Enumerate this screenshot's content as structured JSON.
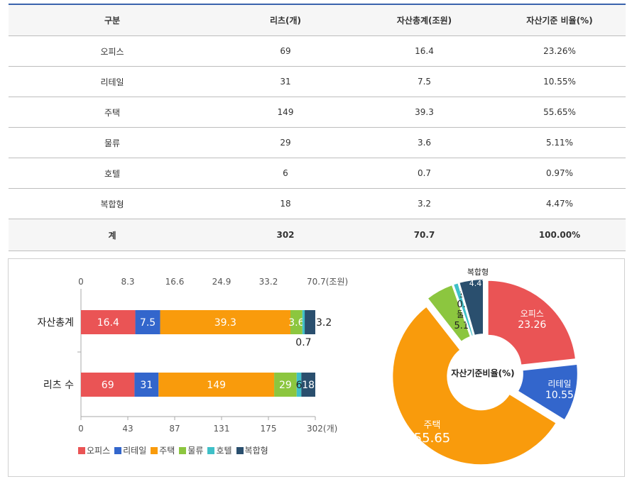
{
  "table": {
    "headers": [
      "구분",
      "리츠(개)",
      "자산총계(조원)",
      "자산기준 비율(%)"
    ],
    "rows": [
      {
        "cat": "오피스",
        "reits": "69",
        "assets": "16.4",
        "ratio": "23.26%"
      },
      {
        "cat": "리테일",
        "reits": "31",
        "assets": "7.5",
        "ratio": "10.55%"
      },
      {
        "cat": "주택",
        "reits": "149",
        "assets": "39.3",
        "ratio": "55.65%"
      },
      {
        "cat": "물류",
        "reits": "29",
        "assets": "3.6",
        "ratio": "5.11%"
      },
      {
        "cat": "호텔",
        "reits": "6",
        "assets": "0.7",
        "ratio": "0.97%"
      },
      {
        "cat": "복합형",
        "reits": "18",
        "assets": "3.2",
        "ratio": "4.47%"
      }
    ],
    "total": {
      "cat": "계",
      "reits": "302",
      "assets": "70.7",
      "ratio": "100.00%"
    }
  },
  "chart_data": [
    {
      "type": "bar",
      "orientation": "horizontal",
      "stacked": true,
      "categories": [
        "자산총계",
        "리츠 수"
      ],
      "series": [
        {
          "name": "오피스",
          "values": [
            16.4,
            69
          ],
          "color": "#ea5455"
        },
        {
          "name": "리테일",
          "values": [
            7.5,
            31
          ],
          "color": "#3366cc"
        },
        {
          "name": "주택",
          "values": [
            39.3,
            149
          ],
          "color": "#f99b0c"
        },
        {
          "name": "물류",
          "values": [
            3.6,
            29
          ],
          "color": "#8cc63f"
        },
        {
          "name": "호텔",
          "values": [
            0.7,
            6
          ],
          "color": "#3fc0c8"
        },
        {
          "name": "복합형",
          "values": [
            3.2,
            18
          ],
          "color": "#2a4f6e"
        }
      ],
      "top_axis": {
        "ticks": [
          "0",
          "8.3",
          "16.6",
          "24.9",
          "33.2",
          "70.7(조원)"
        ],
        "max": 70.7
      },
      "bottom_axis": {
        "ticks": [
          "0",
          "43",
          "87",
          "131",
          "175",
          "302(개)"
        ],
        "max": 302
      },
      "legend_position": "bottom"
    },
    {
      "type": "pie",
      "donut": true,
      "center_label": "자산기준비율(%)",
      "slices": [
        {
          "label": "오피스",
          "value": 23.26,
          "color": "#ea5455"
        },
        {
          "label": "리테일",
          "value": 10.55,
          "color": "#3366cc"
        },
        {
          "label": "주택",
          "value": 55.65,
          "color": "#f99b0c"
        },
        {
          "label": "물류",
          "value": 5.11,
          "color": "#8cc63f"
        },
        {
          "label": "호텔",
          "value": 0.97,
          "color": "#3fc0c8"
        },
        {
          "label": "복합형",
          "value": 4.47,
          "color": "#2a4f6e"
        }
      ]
    }
  ]
}
